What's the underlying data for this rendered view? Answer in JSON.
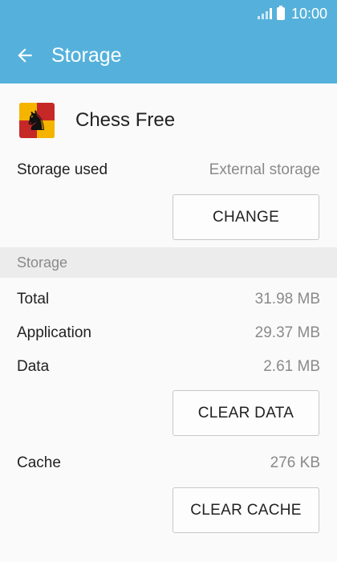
{
  "status_bar": {
    "time": "10:00"
  },
  "app_bar": {
    "title": "Storage"
  },
  "app": {
    "name": "Chess Free"
  },
  "storage_used": {
    "label": "Storage used",
    "value": "External storage",
    "change_label": "CHANGE"
  },
  "storage_section": {
    "header": "Storage",
    "rows": [
      {
        "label": "Total",
        "value": "31.98 MB"
      },
      {
        "label": "Application",
        "value": "29.37 MB"
      },
      {
        "label": "Data",
        "value": "2.61 MB"
      }
    ],
    "clear_data_label": "CLEAR DATA"
  },
  "cache": {
    "label": "Cache",
    "value": "276 KB",
    "clear_cache_label": "CLEAR CACHE"
  },
  "colors": {
    "accent": "#55b1db"
  },
  "icons": {
    "back": "arrow-left-icon",
    "app": "chess-knight-icon"
  }
}
